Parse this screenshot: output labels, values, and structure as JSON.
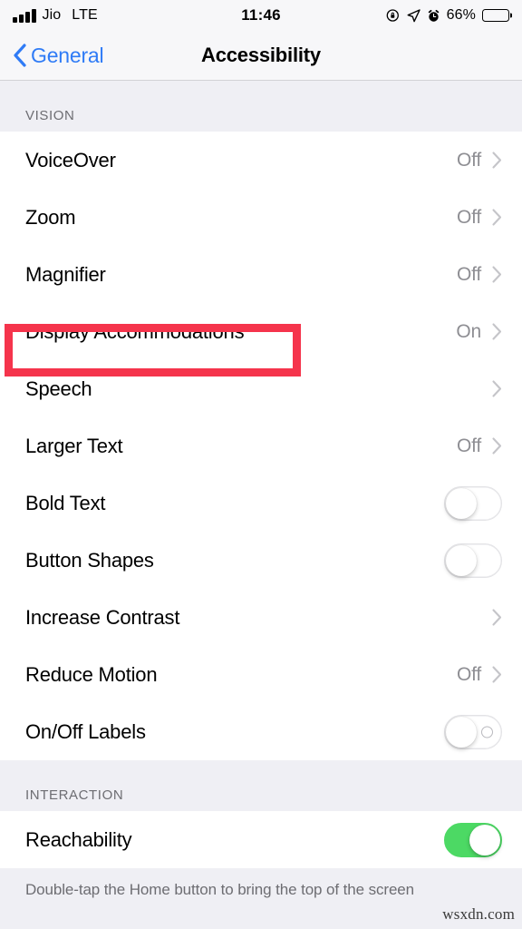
{
  "status_bar": {
    "carrier": "Jio",
    "network": "LTE",
    "time": "11:46",
    "battery_percent": "66%",
    "battery_level": 66,
    "icons": [
      "signal-bars-icon",
      "rotation-lock-icon",
      "location-arrow-icon",
      "alarm-clock-icon",
      "battery-icon"
    ]
  },
  "nav_bar": {
    "back_label": "General",
    "title": "Accessibility",
    "back_tint": "#2f7bf6"
  },
  "sections": [
    {
      "header": "VISION",
      "rows": [
        {
          "label": "VoiceOver",
          "value": "Off",
          "control": "chevron"
        },
        {
          "label": "Zoom",
          "value": "Off",
          "control": "chevron"
        },
        {
          "label": "Magnifier",
          "value": "Off",
          "control": "chevron"
        },
        {
          "label": "Display Accommodations",
          "value": "On",
          "control": "chevron",
          "highlighted": true
        },
        {
          "label": "Speech",
          "value": "",
          "control": "chevron"
        },
        {
          "label": "Larger Text",
          "value": "Off",
          "control": "chevron"
        },
        {
          "label": "Bold Text",
          "value": "",
          "control": "toggle",
          "toggle_state": "off"
        },
        {
          "label": "Button Shapes",
          "value": "",
          "control": "toggle",
          "toggle_state": "off"
        },
        {
          "label": "Increase Contrast",
          "value": "",
          "control": "chevron"
        },
        {
          "label": "Reduce Motion",
          "value": "Off",
          "control": "chevron"
        },
        {
          "label": "On/Off Labels",
          "value": "",
          "control": "toggle",
          "toggle_state": "off-labeled"
        }
      ]
    },
    {
      "header": "INTERACTION",
      "rows": [
        {
          "label": "Reachability",
          "value": "",
          "control": "toggle",
          "toggle_state": "on"
        }
      ],
      "footer": "Double-tap the Home button to bring the top of the screen"
    }
  ],
  "annotation": {
    "type": "highlight-rectangle",
    "color": "#f5344c",
    "target_label": "Display Accommodations"
  },
  "watermark": {
    "text": "wsxdn.com"
  },
  "colors": {
    "accent_blue": "#2f7bf6",
    "toggle_on_green": "#4cd964",
    "section_bg": "#efeff4",
    "row_bg": "#ffffff",
    "secondary_text": "#8e8e93",
    "annotation_red": "#f5344c"
  }
}
